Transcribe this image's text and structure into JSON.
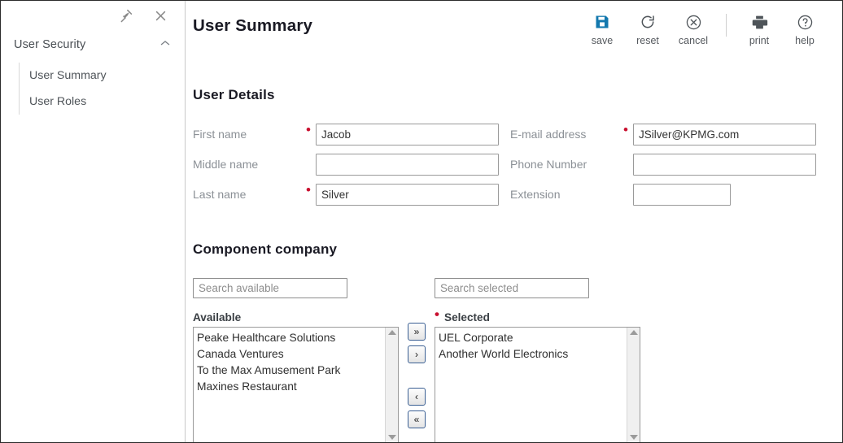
{
  "sidebar": {
    "pin_icon": "pin-icon",
    "close_icon": "close-icon",
    "group": {
      "label": "User Security",
      "collapse_icon": "chevron-up-icon"
    },
    "items": [
      {
        "label": "User Summary"
      },
      {
        "label": "User Roles"
      }
    ]
  },
  "header": {
    "title": "User Summary",
    "toolbar": [
      {
        "label": "save",
        "icon": "save-floppy-icon",
        "color": "#1378ae"
      },
      {
        "label": "reset",
        "icon": "refresh-icon",
        "color": "#4e5459"
      },
      {
        "label": "cancel",
        "icon": "cancel-circle-icon",
        "color": "#4e5459"
      },
      {
        "label": "print",
        "icon": "printer-icon",
        "color": "#4e5459"
      },
      {
        "label": "help",
        "icon": "question-circle-icon",
        "color": "#4e5459"
      }
    ]
  },
  "user_details": {
    "title": "User Details",
    "fields": [
      {
        "label": "First name",
        "value": "Jacob",
        "required": true,
        "width": "wide"
      },
      {
        "label": "E-mail address",
        "value": "JSilver@KPMG.com",
        "required": true,
        "width": "wide"
      },
      {
        "label": "Middle name",
        "value": "",
        "required": false,
        "width": "wide"
      },
      {
        "label": "Phone Number",
        "value": "",
        "required": false,
        "width": "wide"
      },
      {
        "label": "Last name",
        "value": "Silver",
        "required": true,
        "width": "wide"
      },
      {
        "label": "Extension",
        "value": "",
        "required": false,
        "width": "narrow"
      }
    ]
  },
  "component_company": {
    "title": "Component company",
    "search_available_placeholder": "Search available",
    "search_available_value": "",
    "search_selected_placeholder": "Search selected",
    "search_selected_value": "",
    "available_label": "Available",
    "selected_label": "Selected",
    "selected_required": true,
    "available_items": [
      "Peake Healthcare Solutions",
      "Canada Ventures",
      "To the Max Amusement Park",
      "Maxines Restaurant"
    ],
    "selected_items": [
      "UEL Corporate",
      "Another World Electronics"
    ],
    "transfer_buttons": [
      {
        "label": "»",
        "name": "move-all-right-button"
      },
      {
        "label": "›",
        "name": "move-right-button"
      },
      {
        "label": "‹",
        "name": "move-left-button"
      },
      {
        "label": "«",
        "name": "move-all-left-button"
      }
    ]
  },
  "colors": {
    "accent_blue": "#1378ae",
    "required_red": "#c9102f",
    "label_gray": "#8b9096",
    "title_dark": "#1a1a24"
  }
}
